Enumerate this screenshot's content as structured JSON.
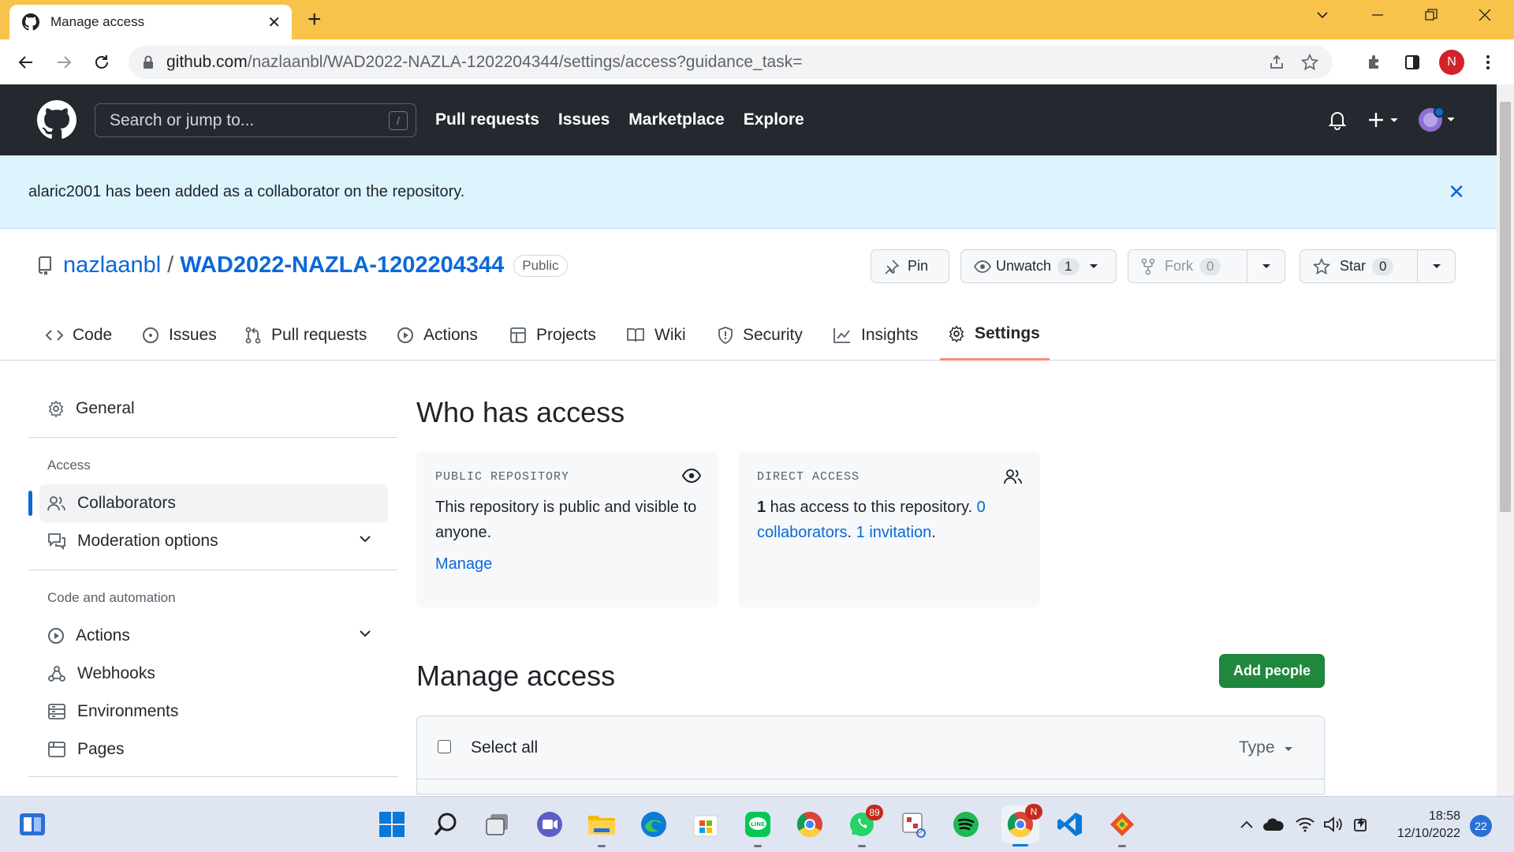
{
  "browser": {
    "tab_title": "Manage access",
    "tab_close": "✕",
    "new_tab": "+",
    "url_host": "github.com",
    "url_path": "/nazlaanbl/WAD2022-NAZLA-1202204344/settings/access?guidance_task=",
    "profile_initial": "N"
  },
  "github": {
    "search_placeholder": "Search or jump to...",
    "search_shortcut": "/",
    "nav": [
      "Pull requests",
      "Issues",
      "Marketplace",
      "Explore"
    ]
  },
  "flash": {
    "message": "alaric2001 has been added as a collaborator on the repository.",
    "close": "✕"
  },
  "repo": {
    "owner": "nazlaanbl",
    "separator": "/",
    "name": "WAD2022-NAZLA-1202204344",
    "visibility": "Public",
    "pin_label": "Pin",
    "unwatch_label": "Unwatch",
    "unwatch_count": "1",
    "fork_label": "Fork",
    "fork_count": "0",
    "star_label": "Star",
    "star_count": "0",
    "tabs": [
      "Code",
      "Issues",
      "Pull requests",
      "Actions",
      "Projects",
      "Wiki",
      "Security",
      "Insights",
      "Settings"
    ]
  },
  "sidebar": {
    "general": "General",
    "access_heading": "Access",
    "collaborators": "Collaborators",
    "moderation": "Moderation options",
    "code_heading": "Code and automation",
    "actions": "Actions",
    "webhooks": "Webhooks",
    "environments": "Environments",
    "pages": "Pages"
  },
  "main": {
    "who_heading": "Who has access",
    "public_card": {
      "label": "PUBLIC REPOSITORY",
      "text": "This repository is public and visible to anyone.",
      "link": "Manage"
    },
    "direct_card": {
      "label": "DIRECT ACCESS",
      "count": "1",
      "text": " has access to this repository. ",
      "collaborators_link": "0 collaborators",
      "dot1": ". ",
      "invitation_link": "1 invitation",
      "dot2": "."
    },
    "manage_heading": "Manage access",
    "add_button": "Add people",
    "select_all": "Select all",
    "type_filter": "Type"
  },
  "taskbar": {
    "whatsapp_badge": "89",
    "chrome_badge": "N",
    "time": "18:58",
    "date": "12/10/2022",
    "notifications": "22"
  },
  "colors": {
    "chrome_frame": "#f8c34a",
    "github_header": "#24292f",
    "flash_bg": "#ddf4ff",
    "link": "#0969da",
    "primary_button": "#1f883d",
    "active_tab_underline": "#fd8c73"
  }
}
